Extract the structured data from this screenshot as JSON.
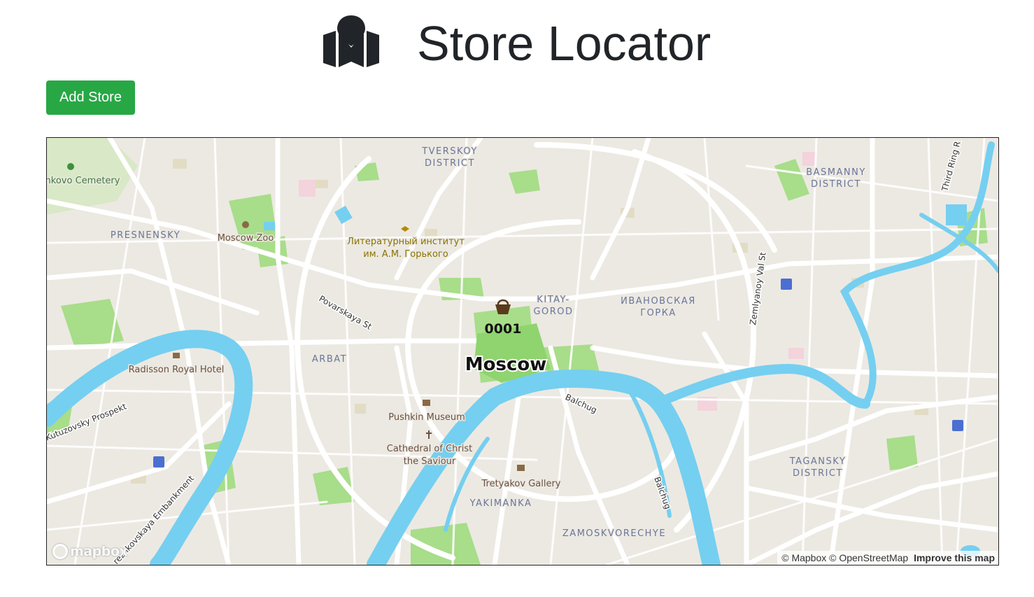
{
  "header": {
    "title": "Store Locator",
    "icon": "map-marker-icon"
  },
  "toolbar": {
    "add_store_label": "Add Store"
  },
  "colors": {
    "primary_button": "#28a745",
    "water": "#75cff0",
    "park": "#a8dd8a",
    "land": "#ece9e2",
    "road": "#ffffff",
    "text_dark": "#212529"
  },
  "map": {
    "city_label": "Moscow",
    "store_marker": {
      "label": "0001",
      "icon": "basket-icon"
    },
    "districts": {
      "tverskoy_1": "TVERSKOY",
      "tverskoy_2": "DISTRICT",
      "basmanny_1": "BASMANNY",
      "basmanny_2": "DISTRICT",
      "presnensky": "PRESNENSKY",
      "arbat": "ARBAT",
      "kitay_1": "KITAY-",
      "kitay_2": "GOROD",
      "ivanovskaya_1": "ИВАНОВСКАЯ",
      "ivanovskaya_2": "ГОРКА",
      "tagansky_1": "TAGANSKY",
      "tagansky_2": "DISTRICT",
      "yakimanka": "YAKIMANKA",
      "zamoskvorechye": "ZAMOSKVORECHYE"
    },
    "pois": {
      "cemetery": "nkovo Cemetery",
      "zoo": "Moscow Zoo",
      "institute_1": "Литературный институт",
      "institute_2": "им. А.М. Горького",
      "hotel": "Radisson Royal Hotel",
      "pushkin": "Pushkin Museum",
      "cathedral_1": "Cathedral of Christ",
      "cathedral_2": "the Saviour",
      "tretyakov": "Tretyakov Gallery"
    },
    "streets": {
      "povarskaya": "Povarskaya St",
      "kutuzovsky": "Kutuzovsky Prospekt",
      "balchug_1": "Balchug",
      "balchug_2": "Balchug",
      "zemlyanoy": "Zemlyanoy Val St",
      "third_ring": "Third Ring R",
      "embankment": "rezhkovskaya Embankment"
    },
    "logo_text": "mapbox",
    "attribution": {
      "mapbox": "© Mapbox",
      "osm": "© OpenStreetMap",
      "improve": "Improve this map"
    }
  }
}
